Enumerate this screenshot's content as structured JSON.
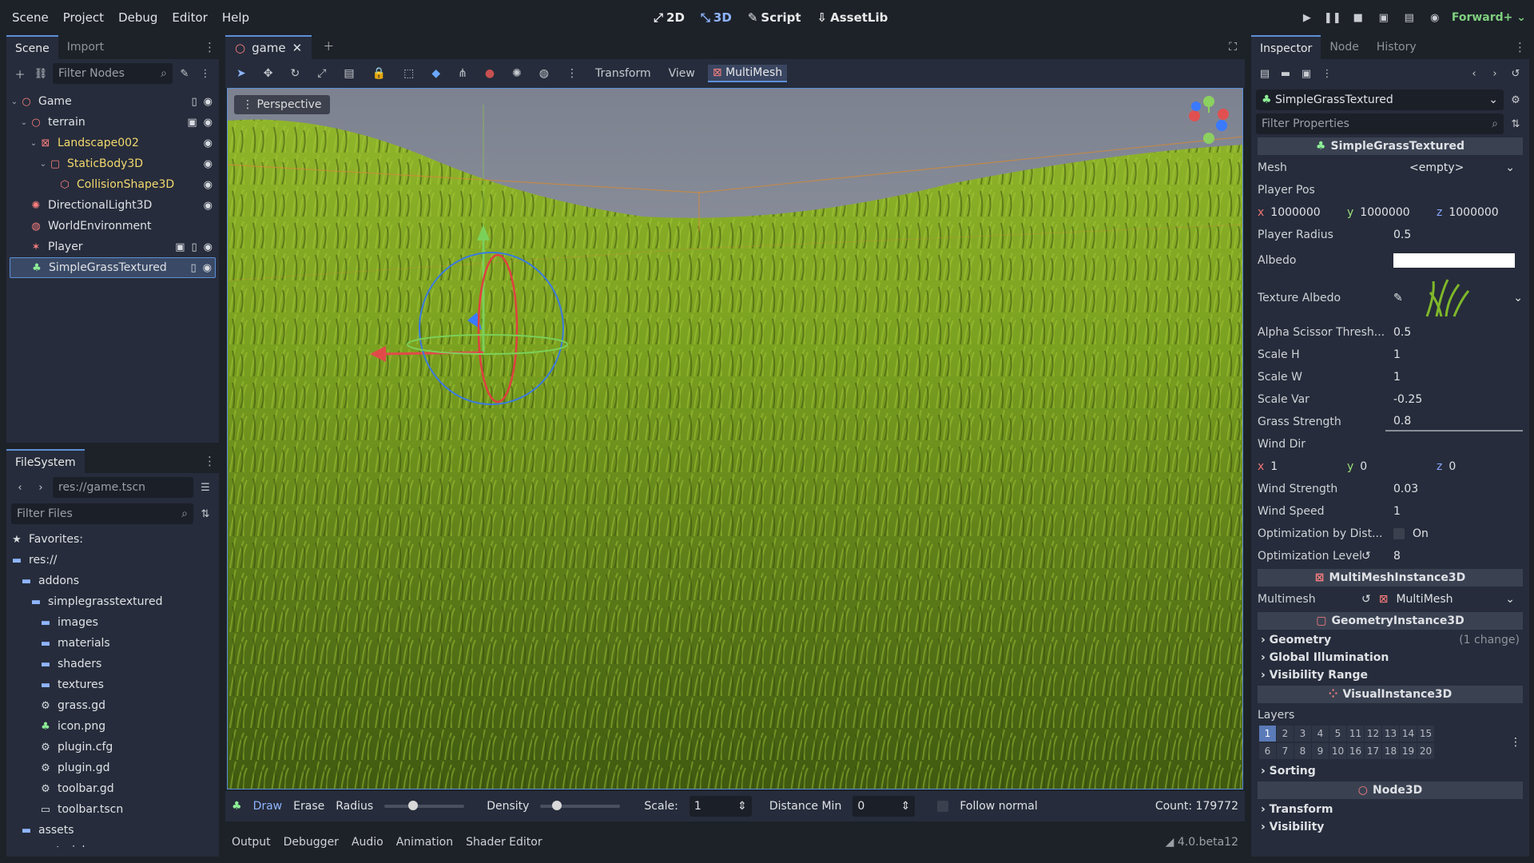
{
  "menu": [
    "Scene",
    "Project",
    "Debug",
    "Editor",
    "Help"
  ],
  "workspaces": [
    {
      "label": "2D",
      "icon": "2d-icon",
      "active": false
    },
    {
      "label": "3D",
      "icon": "3d-icon",
      "active": true
    },
    {
      "label": "Script",
      "icon": "script-icon",
      "active": false
    },
    {
      "label": "AssetLib",
      "icon": "assetlib-icon",
      "active": false
    }
  ],
  "renderer": "Forward+",
  "scene_dock": {
    "tabs": [
      "Scene",
      "Import"
    ],
    "filter_placeholder": "Filter Nodes",
    "nodes": [
      {
        "name": "Game",
        "depth": 0,
        "expanded": true,
        "icon": "node3d-icon",
        "color": "#fc7f7f"
      },
      {
        "name": "terrain",
        "depth": 1,
        "expanded": true,
        "icon": "node3d-icon",
        "color": "#fc7f7f"
      },
      {
        "name": "Landscape002",
        "depth": 2,
        "expanded": true,
        "icon": "mesh-icon",
        "color": "#f3d96e"
      },
      {
        "name": "StaticBody3D",
        "depth": 3,
        "expanded": true,
        "icon": "staticbody-icon",
        "color": "#f3d96e"
      },
      {
        "name": "CollisionShape3D",
        "depth": 4,
        "expanded": false,
        "icon": "collision-icon",
        "color": "#f3d96e"
      },
      {
        "name": "DirectionalLight3D",
        "depth": 1,
        "expanded": false,
        "icon": "light-icon",
        "color": "#fc7f7f"
      },
      {
        "name": "WorldEnvironment",
        "depth": 1,
        "expanded": false,
        "icon": "environment-icon",
        "color": "#fc7f7f"
      },
      {
        "name": "Player",
        "depth": 1,
        "expanded": false,
        "icon": "player-icon",
        "color": "#fc7f7f"
      },
      {
        "name": "SimpleGrassTextured",
        "depth": 1,
        "expanded": false,
        "icon": "grass-icon",
        "color": "#8eef97",
        "selected": true
      }
    ]
  },
  "filesystem": {
    "tab": "FileSystem",
    "path": "res://game.tscn",
    "filter_placeholder": "Filter Files",
    "items": [
      {
        "name": "Favorites:",
        "depth": 0,
        "icon": "star-icon"
      },
      {
        "name": "res://",
        "depth": 0,
        "icon": "folder-icon"
      },
      {
        "name": "addons",
        "depth": 1,
        "icon": "folder-icon"
      },
      {
        "name": "simplegrasstextured",
        "depth": 2,
        "icon": "folder-icon"
      },
      {
        "name": "images",
        "depth": 3,
        "icon": "folder-icon"
      },
      {
        "name": "materials",
        "depth": 3,
        "icon": "folder-icon"
      },
      {
        "name": "shaders",
        "depth": 3,
        "icon": "folder-icon"
      },
      {
        "name": "textures",
        "depth": 3,
        "icon": "folder-icon"
      },
      {
        "name": "grass.gd",
        "depth": 3,
        "icon": "gear-icon"
      },
      {
        "name": "icon.png",
        "depth": 3,
        "icon": "grass-icon"
      },
      {
        "name": "plugin.cfg",
        "depth": 3,
        "icon": "gear-icon"
      },
      {
        "name": "plugin.gd",
        "depth": 3,
        "icon": "gear-icon"
      },
      {
        "name": "toolbar.gd",
        "depth": 3,
        "icon": "gear-icon"
      },
      {
        "name": "toolbar.tscn",
        "depth": 3,
        "icon": "scene-icon"
      },
      {
        "name": "assets",
        "depth": 1,
        "icon": "folder-icon"
      },
      {
        "name": "materials",
        "depth": 1,
        "icon": "folder-icon"
      }
    ]
  },
  "editor": {
    "tab": "game",
    "toolbar": {
      "transform": "Transform",
      "view": "View",
      "multimesh": "MultiMesh"
    },
    "perspective": "Perspective"
  },
  "grass_tools": {
    "draw": "Draw",
    "erase": "Erase",
    "radius_label": "Radius",
    "radius_fraction": 0.3,
    "density_label": "Density",
    "density_fraction": 0.15,
    "scale_label": "Scale:",
    "scale_value": "1",
    "distance_min_label": "Distance Min",
    "distance_min_value": "0",
    "follow_normal": "Follow normal",
    "count": "Count: 179772"
  },
  "bottom_panel": {
    "tabs": [
      "Output",
      "Debugger",
      "Audio",
      "Animation",
      "Shader Editor"
    ],
    "version": "4.0.beta12"
  },
  "inspector": {
    "tabs": [
      "Inspector",
      "Node",
      "History"
    ],
    "object": "SimpleGrassTextured",
    "filter_placeholder": "Filter Properties",
    "section_main": "SimpleGrassTextured",
    "mesh_label": "Mesh",
    "mesh_value": "<empty>",
    "player_pos_label": "Player Pos",
    "player_pos": {
      "x": "1000000",
      "y": "1000000",
      "z": "1000000"
    },
    "player_radius_label": "Player Radius",
    "player_radius": "0.5",
    "albedo_label": "Albedo",
    "albedo_color": "#ffffff",
    "texture_albedo_label": "Texture Albedo",
    "alpha_label": "Alpha Scissor Thresh...",
    "alpha_value": "0.5",
    "scale_h_label": "Scale H",
    "scale_h": "1",
    "scale_w_label": "Scale W",
    "scale_w": "1",
    "scale_var_label": "Scale Var",
    "scale_var": "-0.25",
    "grass_strength_label": "Grass Strength",
    "grass_strength": "0.8",
    "wind_dir_label": "Wind Dir",
    "wind_dir": {
      "x": "1",
      "y": "0",
      "z": "0"
    },
    "wind_strength_label": "Wind Strength",
    "wind_strength": "0.03",
    "wind_speed_label": "Wind Speed",
    "wind_speed": "1",
    "opt_dist_label": "Optimization by Dist...",
    "opt_dist_value": "On",
    "opt_level_label": "Optimization Level",
    "opt_level": "8",
    "section_multimesh": "MultiMeshInstance3D",
    "multimesh_label": "Multimesh",
    "multimesh_value": "MultiMesh",
    "section_geometry": "GeometryInstance3D",
    "geometry": "Geometry",
    "geometry_change": "(1 change)",
    "global_illumination": "Global Illumination",
    "visibility_range": "Visibility Range",
    "section_visual": "VisualInstance3D",
    "layers_label": "Layers",
    "layers_row1": [
      "1",
      "2",
      "3",
      "4",
      "5",
      "11",
      "12",
      "13",
      "14",
      "15"
    ],
    "layers_row2": [
      "6",
      "7",
      "8",
      "9",
      "10",
      "16",
      "17",
      "18",
      "19",
      "20"
    ],
    "sorting": "Sorting",
    "section_node3d": "Node3D",
    "transform": "Transform",
    "visibility": "Visibility"
  }
}
